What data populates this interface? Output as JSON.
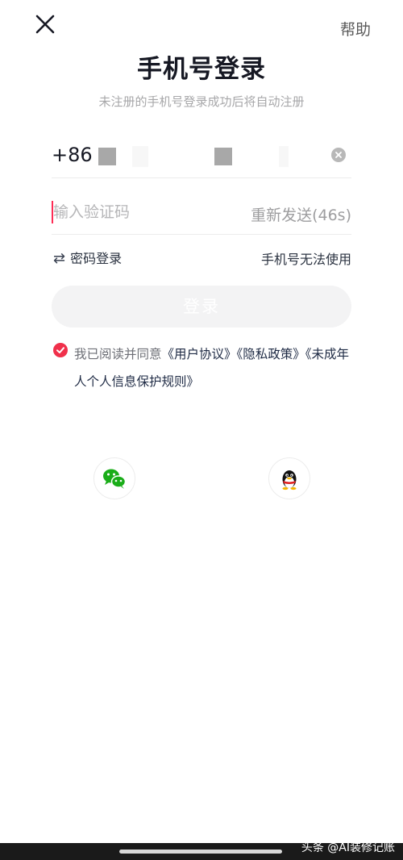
{
  "header": {
    "close_icon": "close-icon",
    "help_label": "帮助"
  },
  "title": "手机号登录",
  "subtitle": "未注册的手机号登录成功后将自动注册",
  "phone": {
    "country_code": "+86",
    "clear_icon": "clear-icon"
  },
  "code": {
    "placeholder": "输入验证码",
    "resend_label": "重新发送(46s)"
  },
  "links": {
    "password_login": "密码登录",
    "phone_unavailable": "手机号无法使用"
  },
  "login_button": "登录",
  "agreement": {
    "prefix": "我已阅读并同意",
    "user_agreement": "《用户协议》",
    "privacy_policy": "《隐私政策》",
    "minor_rules": "《未成年人个人信息保护规则》"
  },
  "social": {
    "wechat_icon": "wechat-icon",
    "qq_icon": "qq-icon"
  },
  "watermark": "头条 @AI装修记账",
  "colors": {
    "accent": "#fe2c55",
    "check": "#f0304b",
    "wechat": "#1aad19"
  }
}
